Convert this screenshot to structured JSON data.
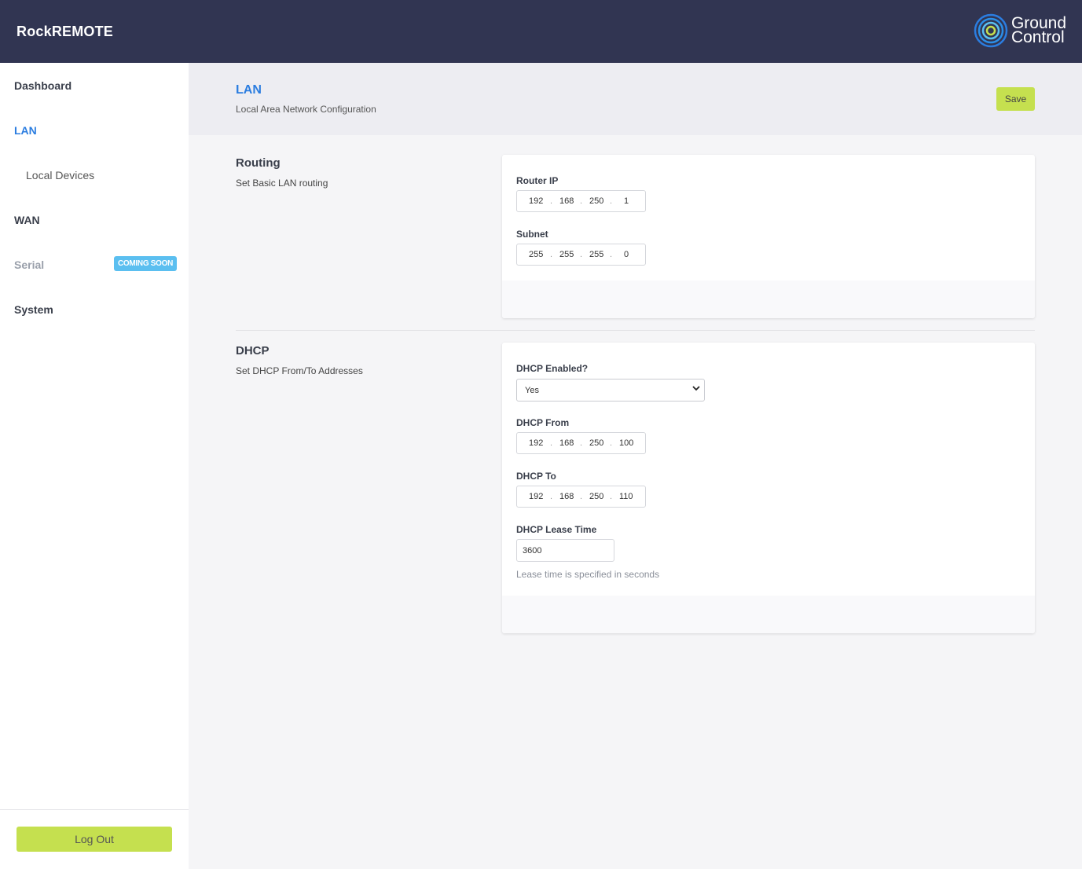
{
  "header": {
    "brand": "RockREMOTE",
    "logo_text_1": "Ground",
    "logo_text_2": "Control"
  },
  "sidebar": {
    "items": [
      {
        "label": "Dashboard"
      },
      {
        "label": "LAN"
      },
      {
        "label": "Local Devices"
      },
      {
        "label": "WAN"
      },
      {
        "label": "Serial",
        "badge": "COMING SOON"
      },
      {
        "label": "System"
      }
    ],
    "logout": "Log Out"
  },
  "page": {
    "title": "LAN",
    "subtitle": "Local Area Network Configuration",
    "save": "Save"
  },
  "routing": {
    "title": "Routing",
    "subtitle": "Set Basic LAN routing",
    "router_ip": {
      "label": "Router IP",
      "octets": [
        "192",
        "168",
        "250",
        "1"
      ]
    },
    "subnet": {
      "label": "Subnet",
      "octets": [
        "255",
        "255",
        "255",
        "0"
      ]
    }
  },
  "dhcp": {
    "title": "DHCP",
    "subtitle": "Set DHCP From/To Addresses",
    "enabled": {
      "label": "DHCP Enabled?",
      "value": "Yes"
    },
    "from": {
      "label": "DHCP From",
      "octets": [
        "192",
        "168",
        "250",
        "100"
      ]
    },
    "to": {
      "label": "DHCP To",
      "octets": [
        "192",
        "168",
        "250",
        "110"
      ]
    },
    "lease": {
      "label": "DHCP Lease Time",
      "value": "3600",
      "help": "Lease time is specified in seconds"
    }
  },
  "colors": {
    "header": "#313552",
    "accent": "#2b7de0",
    "button": "#c5e04f",
    "badge": "#5bbff0"
  }
}
